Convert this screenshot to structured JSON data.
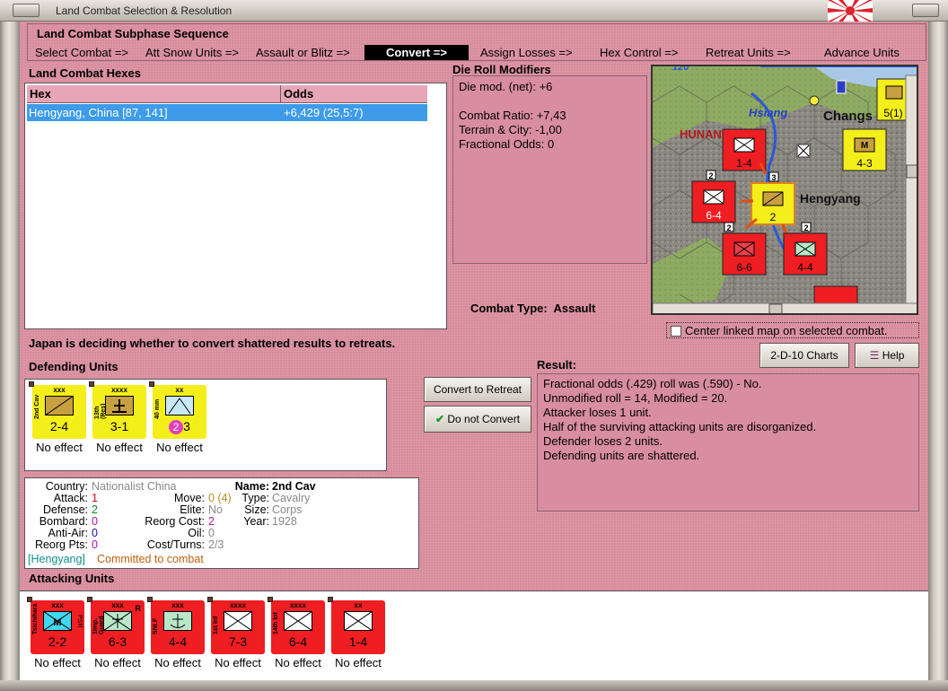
{
  "window": {
    "title": "Land Combat Selection & Resolution"
  },
  "subphase": {
    "title": "Land Combat Subphase Sequence",
    "steps": [
      "Select Combat =>",
      "Att Snow Units =>",
      "Assault or Blitz =>",
      "Convert =>",
      "Assign Losses =>",
      "Hex Control =>",
      "Retreat Units =>",
      "Advance Units"
    ],
    "active_index": 3
  },
  "hexes": {
    "title": "Land Combat Hexes",
    "columns": [
      "Hex",
      "Odds"
    ],
    "rows": [
      {
        "hex": "Hengyang, China [87, 141]",
        "odds": "+6,429 (25,5:7)"
      }
    ]
  },
  "die_roll": {
    "title": "Die Roll Modifiers",
    "lines": [
      "Die mod. (net): +6",
      "",
      "Combat Ratio: +7,43",
      "Terrain & City: -1,00",
      "Fractional Odds: 0"
    ]
  },
  "combat_type": {
    "label": "Combat Type:",
    "value": "Assault"
  },
  "map": {
    "labels": {
      "hsiang": "Hsiang",
      "hunan": "HUNAN",
      "changsha": "Changs",
      "hengyang": "Hengyang",
      "top_num": "120"
    },
    "counters": [
      {
        "val": "1-4",
        "size": "xx",
        "color": "red"
      },
      {
        "val": "4-3",
        "size": "xxxx",
        "color": "yellow"
      },
      {
        "val": "6-4",
        "size": "xxxx",
        "color": "red",
        "stack": "2"
      },
      {
        "val": "2",
        "size": "xxx",
        "color": "yellow",
        "stack": "3"
      },
      {
        "val": "6-6",
        "size": "xxx",
        "color": "red",
        "stack": "2"
      },
      {
        "val": "4-4",
        "size": "xxx",
        "color": "red",
        "stack": "2"
      },
      {
        "val": "5(1)",
        "size": "xxxx",
        "color": "yellow"
      }
    ]
  },
  "center_linked": {
    "label": "Center linked map on selected combat.",
    "checked": false
  },
  "status_message": "Japan is deciding whether to convert shattered results to retreats.",
  "buttons": {
    "charts": "2-D-10 Charts",
    "help": "Help",
    "convert": "Convert to Retreat",
    "no_convert": "Do not Convert"
  },
  "defending": {
    "title": "Defending Units",
    "units": [
      {
        "side": "2nd Cav",
        "size": "xxx",
        "value": "2-4",
        "result": "No effect",
        "type": "cavalry"
      },
      {
        "side": "13th (Res)",
        "size": "xxxx",
        "value": "3-1",
        "result": "No effect",
        "type": "hq"
      },
      {
        "side": "40 mm",
        "size": "xx",
        "value_badge": "2",
        "value": "3",
        "result": "No effect",
        "type": "aa"
      }
    ]
  },
  "unit_info": {
    "country_label": "Country:",
    "country": "Nationalist China",
    "attack_label": "Attack:",
    "attack": "1",
    "defense_label": "Defense:",
    "defense": "2",
    "bombard_label": "Bombard:",
    "bombard": "0",
    "antiair_label": "Anti-Air:",
    "antiair": "0",
    "reorgpts_label": "Reorg Pts:",
    "reorgpts": "0",
    "move_label": "Move:",
    "move": "0 (4)",
    "elite_label": "Elite:",
    "elite": "No",
    "reorgcost_label": "Reorg Cost:",
    "reorgcost": "2",
    "oil_label": "Oil:",
    "oil": "0",
    "costturns_label": "Cost/Turns:",
    "costturns": "2/3",
    "name_label": "Name:",
    "name": "2nd Cav",
    "type_label": "Type:",
    "type": "Cavalry",
    "size_label": "Size:",
    "size": "Corps",
    "year_label": "Year:",
    "year": "1928",
    "location": "[Hengyang]",
    "status": "Committed to combat"
  },
  "result": {
    "title": "Result:",
    "lines": [
      "Fractional odds (.429) roll was (.590)  -  No.",
      "Unmodified roll = 14, Modified = 20.",
      "Attacker loses 1 unit.",
      "Half of the surviving attacking units are disorganized.",
      "Defender loses 2 units.",
      "Defending units are shattered."
    ]
  },
  "attacking": {
    "title": "Attacking Units",
    "units": [
      {
        "side": "Tsichihara",
        "size": "xxx",
        "value": "2-2",
        "result": "No effect",
        "type": "mech",
        "extra": "PSR"
      },
      {
        "side": "1Imp. Guard",
        "size": "xxx",
        "value": "6-3",
        "result": "No effect",
        "type": "mtn",
        "extra": "R"
      },
      {
        "side": "SNLF",
        "size": "xxx",
        "value": "4-4",
        "result": "No effect",
        "type": "marine",
        "extra": ""
      },
      {
        "side": "1st Inf",
        "size": "xxxx",
        "value": "7-3",
        "result": "No effect",
        "type": "inf",
        "extra": ""
      },
      {
        "side": "14th Inf",
        "size": "xxxx",
        "value": "6-4",
        "result": "No effect",
        "type": "inf",
        "extra": ""
      },
      {
        "side": "",
        "size": "xx",
        "value": "1-4",
        "result": "No effect",
        "type": "inf",
        "extra": ""
      }
    ]
  },
  "colors": {
    "panel": "#d88c9c",
    "selection": "#3d9be9",
    "japan_red": "#ee1e23",
    "china_yellow": "#f4ee1a"
  }
}
